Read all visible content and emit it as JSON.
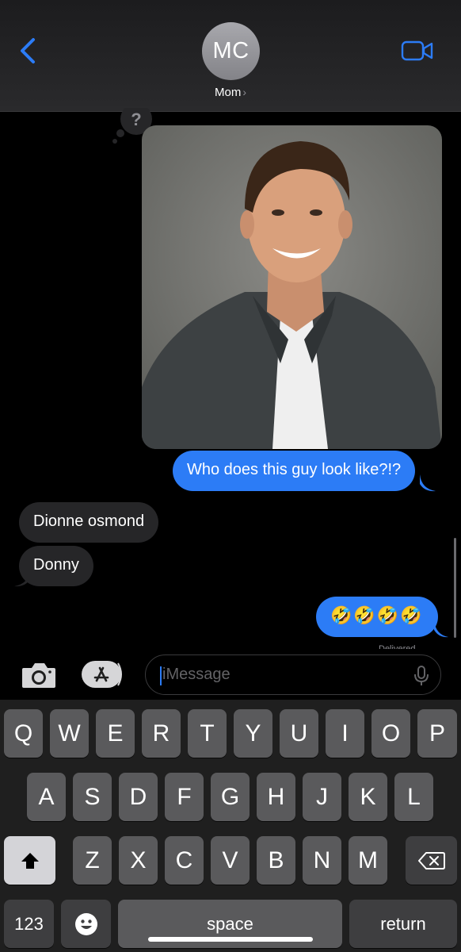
{
  "header": {
    "avatar_initials": "MC",
    "contact_name": "Mom",
    "chevron": "›",
    "back_icon": "chevron-left-icon",
    "video_icon": "video-camera-icon"
  },
  "messages": [
    {
      "direction": "outgoing",
      "type": "image",
      "description_icon": "photo-attachment"
    },
    {
      "direction": "outgoing",
      "type": "text",
      "text": "Who does this guy look like?!?"
    },
    {
      "direction": "incoming",
      "type": "text",
      "text": "Dionne osmond"
    },
    {
      "direction": "incoming",
      "type": "text",
      "text": "Donny"
    },
    {
      "direction": "outgoing",
      "type": "text",
      "text": "🤣🤣🤣🤣"
    }
  ],
  "thought_bubble": {
    "symbol": "?"
  },
  "status": {
    "delivered_partial": "Delivered"
  },
  "composer": {
    "placeholder": "iMessage",
    "camera_icon": "camera-icon",
    "appstore_icon": "app-store-icon",
    "mic_icon": "microphone-icon"
  },
  "keyboard": {
    "row1": [
      "Q",
      "W",
      "E",
      "R",
      "T",
      "Y",
      "U",
      "I",
      "O",
      "P"
    ],
    "row2": [
      "A",
      "S",
      "D",
      "F",
      "G",
      "H",
      "J",
      "K",
      "L"
    ],
    "row3": [
      "Z",
      "X",
      "C",
      "V",
      "B",
      "N",
      "M"
    ],
    "numbers_label": "123",
    "space_label": "space",
    "return_label": "return",
    "shift_icon": "shift-arrow-icon",
    "delete_icon": "backspace-icon",
    "emoji_icon": "emoji-icon"
  },
  "colors": {
    "outgoing_bubble": "#2c7cf6",
    "incoming_bubble": "#262628",
    "accent": "#2c7cf6",
    "keyboard_bg": "#1f1f1f",
    "key": "#5a5a5c"
  }
}
